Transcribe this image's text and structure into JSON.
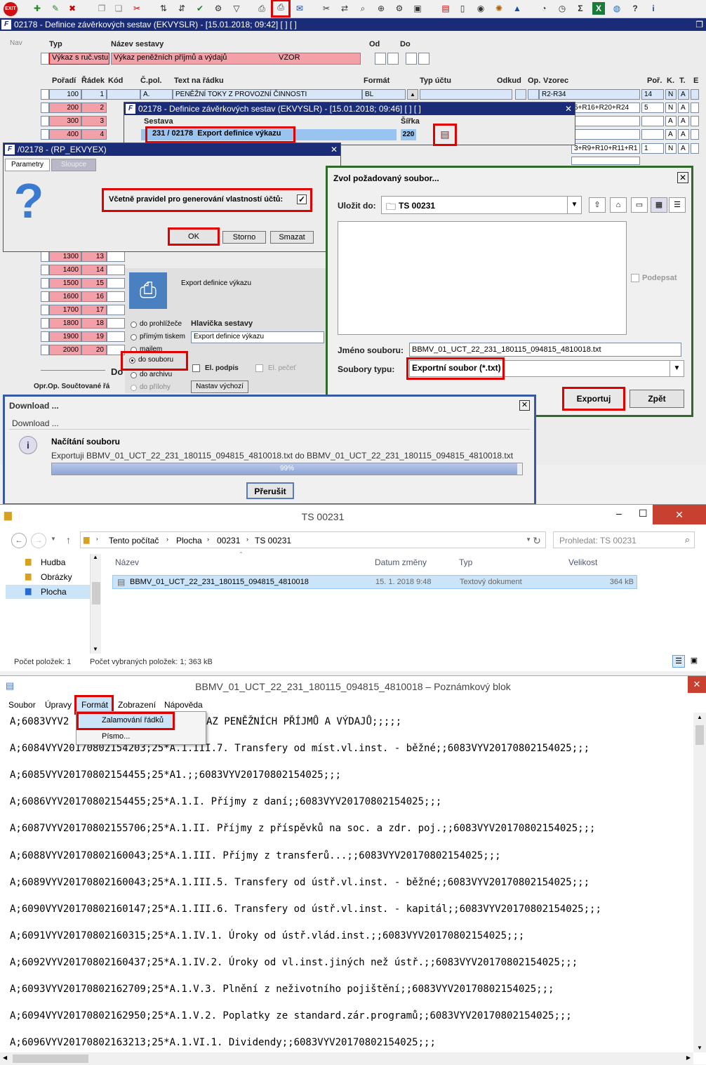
{
  "toolbar": {
    "exit": "EXIT"
  },
  "main_window": {
    "title": "02178 - Definice závěrkových sestav (EKVYSLR) - [15.01.2018; 09:42]  [ ]  [ ]",
    "nav": "Nav"
  },
  "header": {
    "typ_label": "Typ",
    "nazev_label": "Název sestavy",
    "od_label": "Od",
    "do_label": "Do",
    "typ_value": "Výkaz s ruč.vstu",
    "nazev_value": "Výkaz peněžních příjmů a výdajů",
    "vzor": "VZOR"
  },
  "columns": {
    "poradi": "Pořadí",
    "radek": "Řádek",
    "kod": "Kód",
    "cpol": "Č.pol.",
    "text": "Text na řádku",
    "format": "Formát",
    "typ_uctu": "Typ účtu",
    "odkud": "Odkud",
    "op": "Op.",
    "vzorec": "Vzorec",
    "por": "Poř.",
    "k": "K.",
    "t": "T.",
    "e": "E"
  },
  "rows": [
    {
      "poradi": "100",
      "radek": "1",
      "cpol": "A.",
      "text": "PENĚŽNÍ TOKY Z PROVOZNÍ ČINNOSTI",
      "format": "BL",
      "vzorec": "R2-R34",
      "por": "14",
      "k": "N",
      "t": "A"
    },
    {
      "poradi": "200",
      "radek": "2",
      "vzorec": "5+R16+R20+R24",
      "por": "5",
      "k": "N",
      "t": "A"
    },
    {
      "poradi": "300",
      "radek": "3",
      "k": "A",
      "t": "A"
    },
    {
      "poradi": "400",
      "radek": "4",
      "k": "A",
      "t": "A"
    },
    {
      "vzorec": "3+R9+R10+R11+R1",
      "por": "1",
      "k": "N",
      "t": "A"
    }
  ],
  "lower_rows": [
    {
      "poradi": "1300",
      "radek": "13"
    },
    {
      "poradi": "1400",
      "radek": "14"
    },
    {
      "poradi": "1500",
      "radek": "15"
    },
    {
      "poradi": "1600",
      "radek": "16"
    },
    {
      "poradi": "1700",
      "radek": "17"
    },
    {
      "poradi": "1800",
      "radek": "18"
    },
    {
      "poradi": "1900",
      "radek": "19"
    },
    {
      "poradi": "2000",
      "radek": "20"
    }
  ],
  "footer_label": "Opr.Op. Součtované řá",
  "do_fragment": "Do",
  "dialog_sestava": {
    "title": "02178 - Definice závěrkových sestav (EKVYSLR) - [15.01.2018; 09:46]  [ ]  [ ]",
    "sestava_label": "Sestava",
    "sirka_label": "Šířka",
    "code": "231 / 02178",
    "name": "Export definice výkazu",
    "sirka": "220"
  },
  "dialog_params": {
    "title": "/02178 - (RP_EKVYEX)",
    "tab_params": "Parametry",
    "tab_sloupce": "Sloupce",
    "checkbox_label": "Včetně pravidel pro generování vlastností účtů:",
    "ok": "OK",
    "storno": "Storno",
    "smazat": "Smazat"
  },
  "print_panel": {
    "title": "Export definice výkazu",
    "opt1": "do prohlížeče",
    "opt2": "přímým tiskem",
    "opt3": "mailem",
    "opt4": "do souboru",
    "opt5": "do archivu",
    "opt6": "do přílohy",
    "hlavicka_label": "Hlavička sestavy",
    "hlavicka_value": "Export definice výkazu",
    "el_podpis": "El. podpis",
    "el_pecet": "El. pečeť",
    "nastav": "Nastav výchozí"
  },
  "save_dialog": {
    "title": "Zvol požadovaný soubor...",
    "ulozit_label": "Uložit do:",
    "folder": "TS 00231",
    "podepsat": "Podepsat",
    "jmeno_label": "Jméno souboru:",
    "jmeno_value": "BBMV_01_UCT_22_231_180115_094815_4810018.txt",
    "typ_label": "Soubory typu:",
    "typ_value": "Exportní soubor (*.txt)",
    "export": "Exportuj",
    "zpet": "Zpět"
  },
  "download": {
    "title": "Download ...",
    "subtitle": "Download ...",
    "heading": "Načítání souboru",
    "text": "Exportuji BBMV_01_UCT_22_231_180115_094815_4810018.txt do BBMV_01_UCT_22_231_180115_094815_4810018.txt",
    "progress": 99,
    "progress_label": "99%",
    "button": "Přerušit"
  },
  "explorer": {
    "title": "TS 00231",
    "crumbs": [
      "Tento počítač",
      "Plocha",
      "00231",
      "TS 00231"
    ],
    "search": "Prohledat: TS 00231",
    "nav": [
      "Hudba",
      "Obrázky",
      "Plocha"
    ],
    "cols": {
      "name": "Název",
      "date": "Datum změny",
      "type": "Typ",
      "size": "Velikost"
    },
    "file": {
      "name": "BBMV_01_UCT_22_231_180115_094815_4810018",
      "date": "15. 1. 2018 9:48",
      "type": "Textový dokument",
      "size": "364 kB"
    },
    "status1": "Počet položek: 1",
    "status2": "Počet vybraných položek: 1; 363 kB"
  },
  "notepad": {
    "title": "BBMV_01_UCT_22_231_180115_094815_4810018 – Poznámkový blok",
    "menu": [
      "Soubor",
      "Úpravy",
      "Formát",
      "Zobrazení",
      "Nápověda"
    ],
    "dropdown": [
      "Zalamování řádků",
      "Písmo..."
    ],
    "line0": "A;6083VYV2",
    "line0b": "AZ PENĚŽNÍCH PŘÍJMŮ A VÝDAJŮ;;;;;",
    "lines": [
      "A;6084VYV20170802154203;25*A.1.III.7. Transfery od míst.vl.inst. - běžné;;6083VYV20170802154025;;;",
      "A;6085VYV20170802154455;25*A1.;;6083VYV20170802154025;;;",
      "A;6086VYV20170802154455;25*A.1.I. Příjmy z daní;;6083VYV20170802154025;;;",
      "A;6087VYV20170802155706;25*A.1.II. Příjmy z příspěvků na soc. a zdr. poj.;;6083VYV20170802154025;;;",
      "A;6088VYV20170802160043;25*A.1.III. Příjmy z transferů...;;6083VYV20170802154025;;;",
      "A;6089VYV20170802160043;25*A.1.III.5. Transfery od ústř.vl.inst. - běžné;;6083VYV20170802154025;;;",
      "A;6090VYV20170802160147;25*A.1.III.6. Transfery od ústř.vl.inst. - kapitál;;6083VYV20170802154025;;;",
      "A;6091VYV20170802160315;25*A.1.IV.1. Úroky od ústř.vlád.inst.;;6083VYV20170802154025;;;",
      "A;6092VYV20170802160437;25*A.1.IV.2. Úroky od vl.inst.jiných než ústř.;;6083VYV20170802154025;;;",
      "A;6093VYV20170802162709;25*A.1.V.3. Plnění z neživotního pojištění;;6083VYV20170802154025;;;",
      "A;6094VYV20170802162950;25*A.1.V.2. Poplatky ze standard.zár.programů;;6083VYV20170802154025;;;",
      "A;6096VYV20170802163213;25*A.1.VI.1. Dividendy;;6083VYV20170802154025;;;"
    ]
  }
}
